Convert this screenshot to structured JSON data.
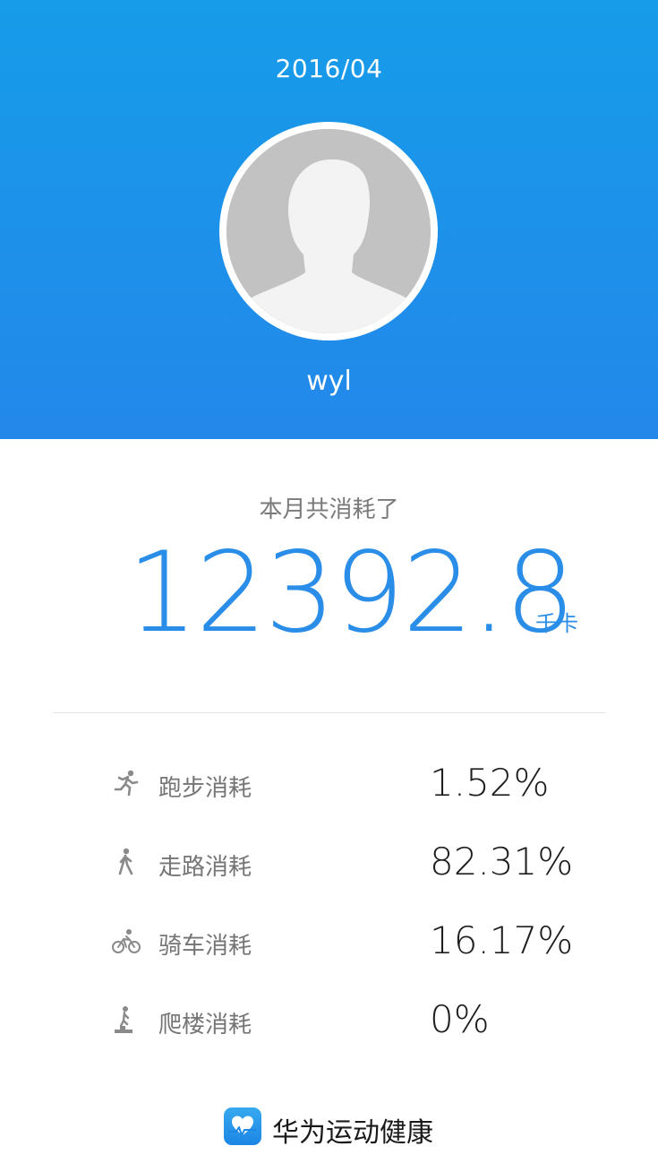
{
  "header": {
    "month": "2016/04",
    "username": "wyl"
  },
  "summary": {
    "label": "本月共消耗了",
    "total": "12392.8",
    "unit": "千卡"
  },
  "stats": [
    {
      "icon": "running-icon",
      "label": "跑步消耗",
      "value": "1.52%"
    },
    {
      "icon": "walking-icon",
      "label": "走路消耗",
      "value": "82.31%"
    },
    {
      "icon": "cycling-icon",
      "label": "骑车消耗",
      "value": "16.17%"
    },
    {
      "icon": "stair-climbing-icon",
      "label": "爬楼消耗",
      "value": "0%"
    }
  ],
  "footer": {
    "app_name": "华为运动健康",
    "logo_icon": "heart-pulse-icon"
  },
  "colors": {
    "header_top": "#169ce9",
    "header_bottom": "#2388ea",
    "accent": "#2a8ee8"
  }
}
